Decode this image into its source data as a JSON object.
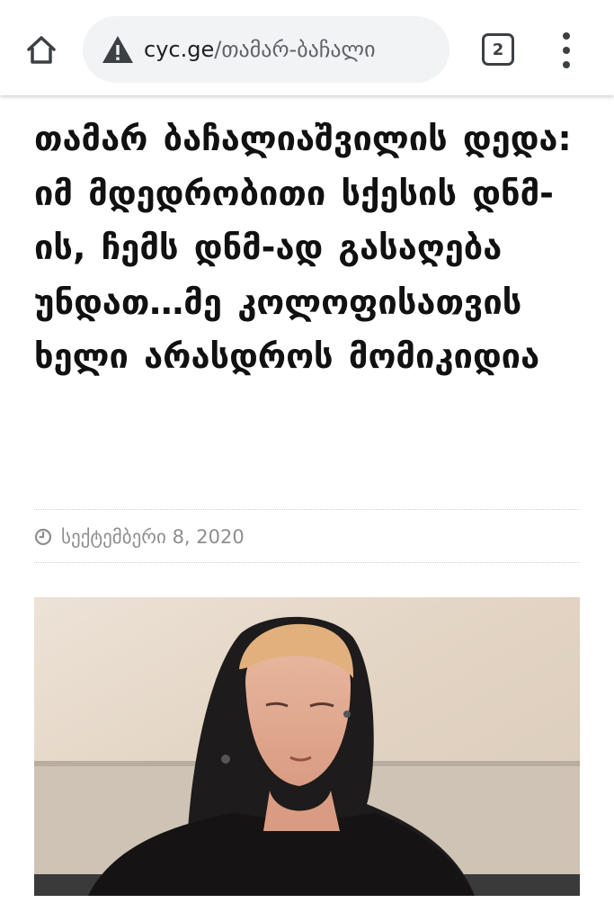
{
  "browser": {
    "url_domain": "cyc.ge",
    "url_path": "/თამარ-ბაჩალი",
    "tab_count": "2",
    "icons": {
      "home": "home-icon",
      "security": "warning-icon",
      "menu": "more-vert-icon"
    }
  },
  "article": {
    "title": "თამარ ბაჩალიაშვილის დედა: იმ მდედრობითი სქესის დნმ-ის, ჩემს დნმ-ად გასაღება უნდათ…მე კოლოფისათვის ხელი არასდროს მომიკიდია",
    "date": "სექტემბერი 8, 2020",
    "date_icon": "clock-icon"
  },
  "colors": {
    "toolbar_bg": "#ffffff",
    "omnibox_bg": "#f1f3f4",
    "icon": "#3c4043",
    "headline": "#111111",
    "meta": "#8e8e8e"
  }
}
